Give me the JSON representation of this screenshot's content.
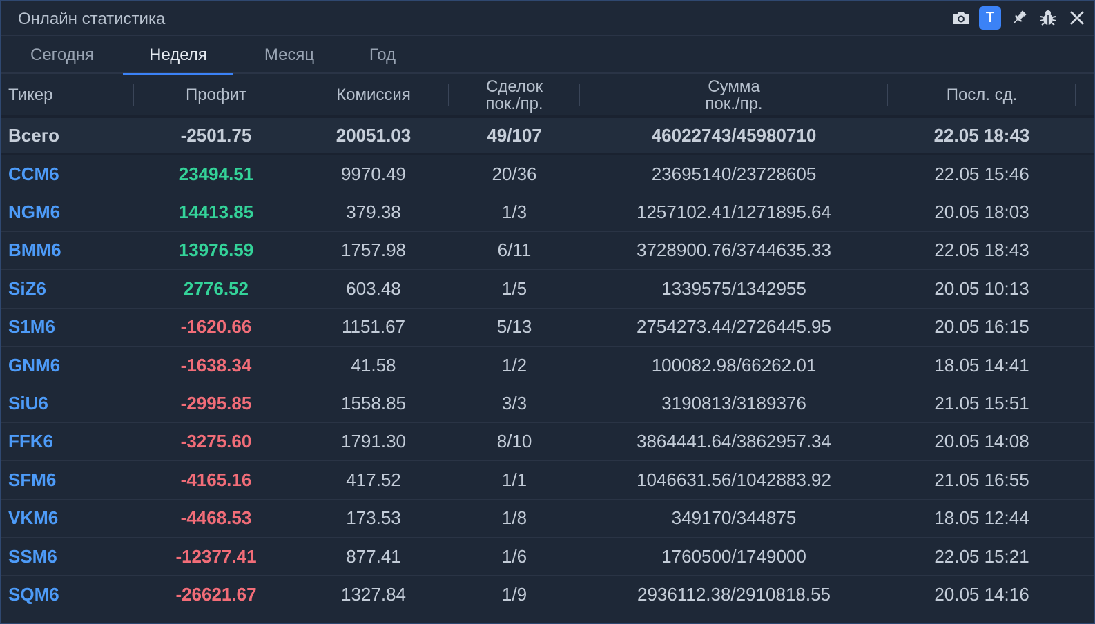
{
  "window": {
    "title": "Онлайн статистика"
  },
  "toolbar": {
    "icons": [
      "camera-icon",
      "t-badge",
      "pin-icon",
      "bug-icon",
      "close-icon"
    ],
    "t_label": "T"
  },
  "tabs": [
    {
      "label": "Сегодня",
      "active": false
    },
    {
      "label": "Неделя",
      "active": true
    },
    {
      "label": "Месяц",
      "active": false
    },
    {
      "label": "Год",
      "active": false
    }
  ],
  "table": {
    "headers": {
      "ticker": "Тикер",
      "profit": "Профит",
      "commission": "Комиссия",
      "deals_1": "Сделок",
      "deals_2": "пок./пр.",
      "sum_1": "Сумма",
      "sum_2": "пок./пр.",
      "last": "Посл. сд."
    },
    "total": {
      "ticker": "Всего",
      "profit": "-2501.75",
      "commission": "20051.03",
      "deals": "49/107",
      "sum": "46022743/45980710",
      "last": "22.05 18:43"
    },
    "rows": [
      {
        "ticker": "CCM6",
        "profit": "23494.51",
        "commission": "9970.49",
        "deals": "20/36",
        "sum": "23695140/23728605",
        "last": "22.05 15:46"
      },
      {
        "ticker": "NGM6",
        "profit": "14413.85",
        "commission": "379.38",
        "deals": "1/3",
        "sum": "1257102.41/1271895.64",
        "last": "20.05 18:03"
      },
      {
        "ticker": "BMM6",
        "profit": "13976.59",
        "commission": "1757.98",
        "deals": "6/11",
        "sum": "3728900.76/3744635.33",
        "last": "22.05 18:43"
      },
      {
        "ticker": "SiZ6",
        "profit": "2776.52",
        "commission": "603.48",
        "deals": "1/5",
        "sum": "1339575/1342955",
        "last": "20.05 10:13"
      },
      {
        "ticker": "S1M6",
        "profit": "-1620.66",
        "commission": "1151.67",
        "deals": "5/13",
        "sum": "2754273.44/2726445.95",
        "last": "20.05 16:15"
      },
      {
        "ticker": "GNM6",
        "profit": "-1638.34",
        "commission": "41.58",
        "deals": "1/2",
        "sum": "100082.98/66262.01",
        "last": "18.05 14:41"
      },
      {
        "ticker": "SiU6",
        "profit": "-2995.85",
        "commission": "1558.85",
        "deals": "3/3",
        "sum": "3190813/3189376",
        "last": "21.05 15:51"
      },
      {
        "ticker": "FFK6",
        "profit": "-3275.60",
        "commission": "1791.30",
        "deals": "8/10",
        "sum": "3864441.64/3862957.34",
        "last": "20.05 14:08"
      },
      {
        "ticker": "SFM6",
        "profit": "-4165.16",
        "commission": "417.52",
        "deals": "1/1",
        "sum": "1046631.56/1042883.92",
        "last": "21.05 16:55"
      },
      {
        "ticker": "VKM6",
        "profit": "-4468.53",
        "commission": "173.53",
        "deals": "1/8",
        "sum": "349170/344875",
        "last": "18.05 12:44"
      },
      {
        "ticker": "SSM6",
        "profit": "-12377.41",
        "commission": "877.41",
        "deals": "1/6",
        "sum": "1760500/1749000",
        "last": "22.05 15:21"
      },
      {
        "ticker": "SQM6",
        "profit": "-26621.67",
        "commission": "1327.84",
        "deals": "1/9",
        "sum": "2936112.38/2910818.55",
        "last": "20.05 14:16"
      }
    ]
  },
  "colors": {
    "accent": "#3b82f6",
    "positive": "#34d399",
    "negative": "#f26d78",
    "ticker": "#4d9bf8",
    "background": "#1e2837"
  }
}
